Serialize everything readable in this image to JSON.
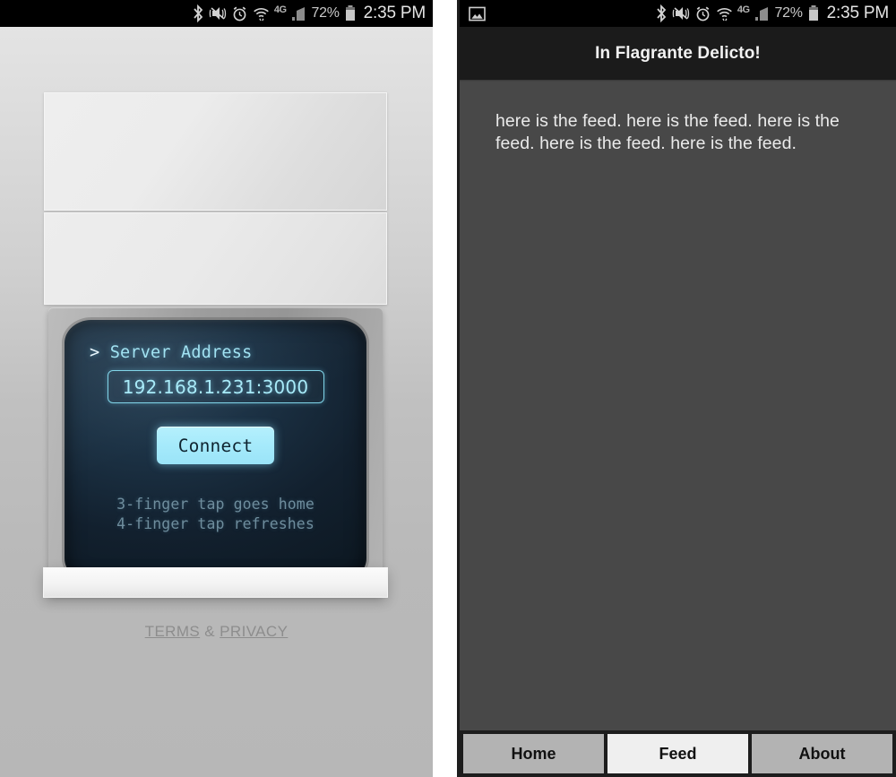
{
  "statusbar": {
    "icons_left": [
      "gallery-image-icon"
    ],
    "icons_right": [
      "bluetooth-icon",
      "vibrate-off-icon",
      "alarm-clock-icon",
      "wifi-icon",
      "lte-icon",
      "signal-bars-icon"
    ],
    "lte_label": "4G",
    "battery_percent": "72%",
    "time": "2:35 PM"
  },
  "left_screen": {
    "terminal": {
      "prompt_caret": ">",
      "label": "Server Address",
      "input_value": "192.168.1.231:3000",
      "input_placeholder": "Server Address",
      "connect_label": "Connect",
      "hints": [
        "3-finger tap goes home",
        "4-finger tap refreshes"
      ],
      "hint_text": "3-finger tap goes home\n4-finger tap refreshes"
    },
    "footer": {
      "terms_label": "TERMS",
      "amp": " & ",
      "privacy_label": "PRIVACY"
    }
  },
  "right_screen": {
    "title": "In Flagrante Delicto!",
    "feed_text": "here is the feed. here is the feed. here is the feed. here is the feed. here is the feed.",
    "tabs": [
      {
        "label": "Home",
        "active": false
      },
      {
        "label": "Feed",
        "active": true
      },
      {
        "label": "About",
        "active": false
      }
    ]
  },
  "colors": {
    "accent_cyan": "#a6eafb",
    "terminal_text": "#9fe2f2",
    "terminal_hint": "#6e8d9d",
    "status_bar_bg": "#000000",
    "app_bar_bg": "#1b1b1b",
    "feed_bg": "#484848",
    "tab_active_bg": "#efefef",
    "tab_inactive_bg": "#b3b3b3"
  }
}
